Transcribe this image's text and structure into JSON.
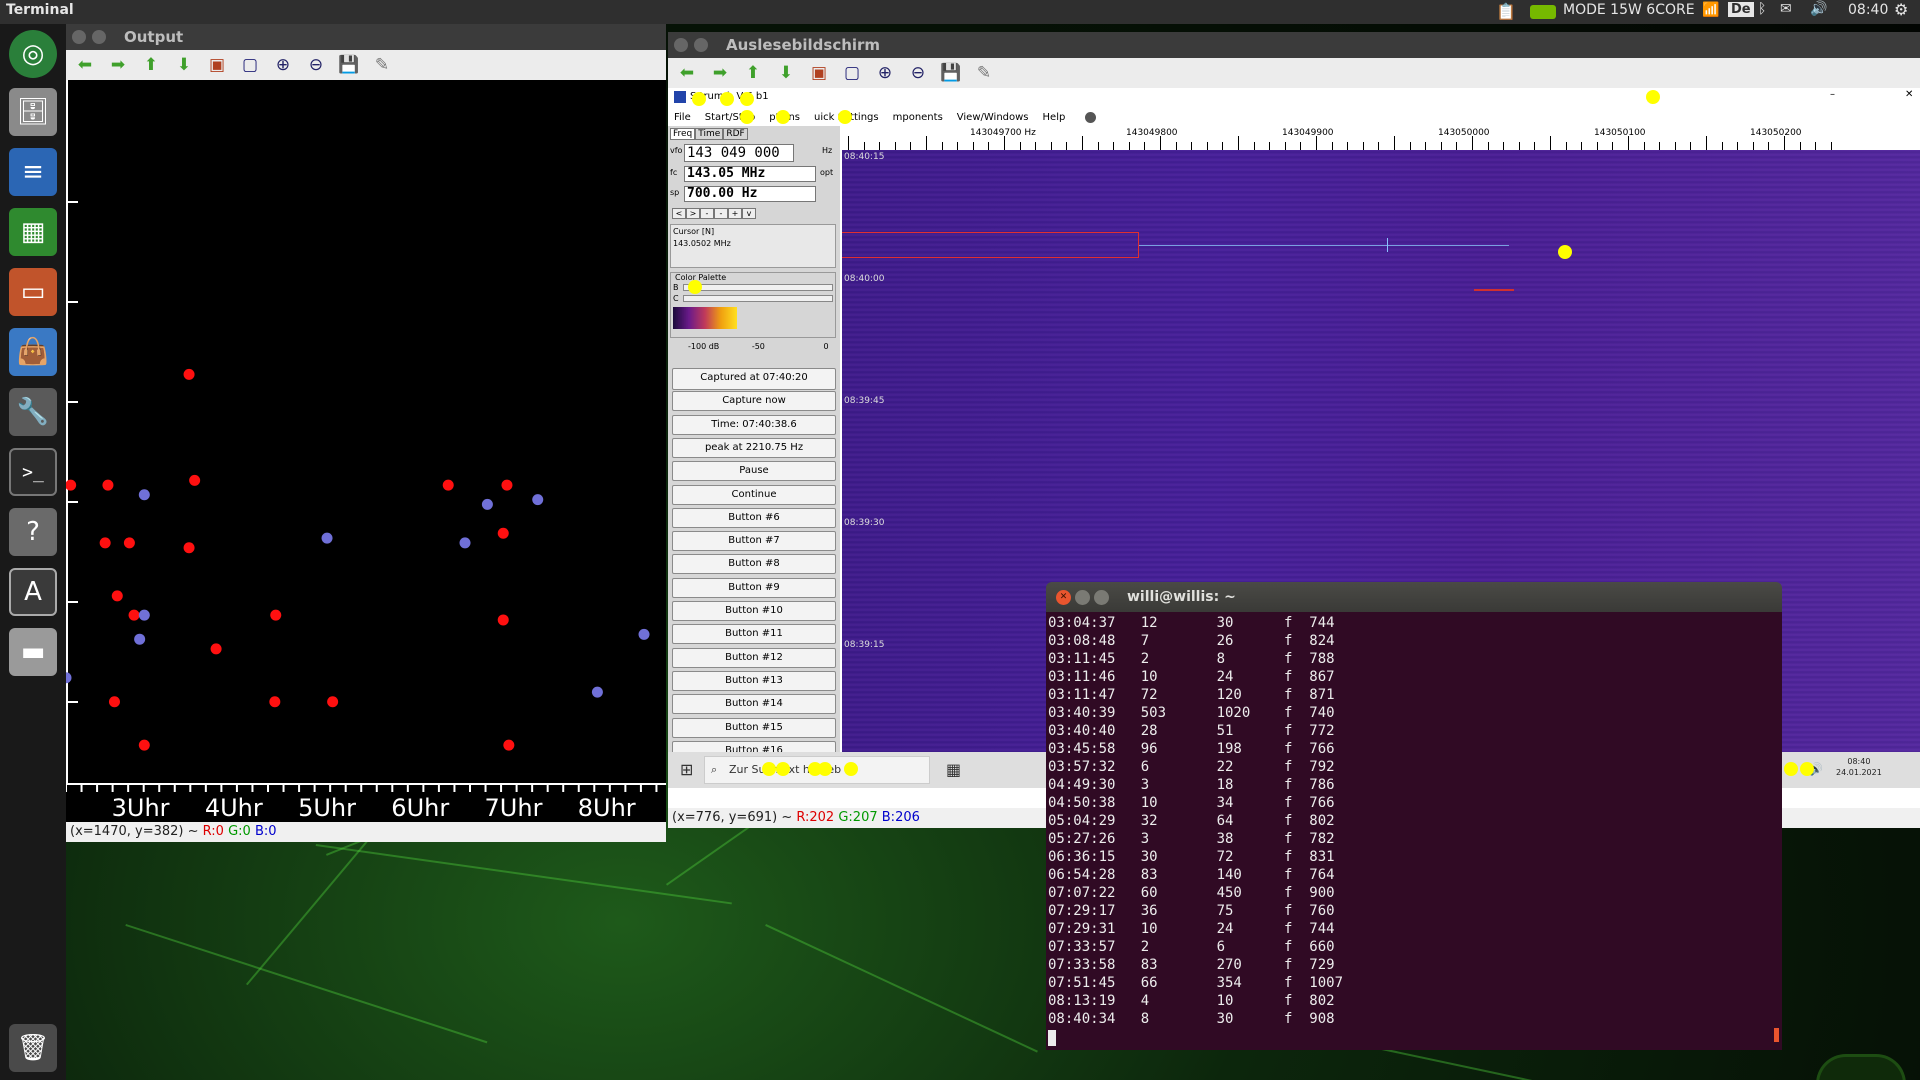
{
  "topbar": {
    "app": "Terminal",
    "gpu": "MODE 15W 6CORE",
    "keyboard": "De",
    "time": "08:40"
  },
  "output": {
    "title": "Output",
    "xticks": [
      "3Uhr",
      "4Uhr",
      "5Uhr",
      "6Uhr",
      "7Uhr",
      "8Uhr"
    ],
    "status_prefix": "(x=1470, y=382) ~ ",
    "status_r": "R:0",
    "status_g": "G:0",
    "status_b": "B:0"
  },
  "ausl": {
    "title": "Auslesebildschirm",
    "status_prefix": "(x=776, y=691) ~ ",
    "status_r": "R:202",
    "status_g": "G:207",
    "status_b": "B:206"
  },
  "sl": {
    "title": "S   trum    b V   6 b1",
    "menu": [
      "File",
      "Start/Stop",
      "  ptions",
      "   uick Settings",
      "   mponents",
      "View/Windows",
      "Help"
    ],
    "tabs": [
      "Freq",
      "Time",
      "RDF"
    ],
    "vfo_label": "vfo",
    "vfo": "143 049 000",
    "vfo_unit": "Hz",
    "fc_label": "fc",
    "fc": "143.05  MHz",
    "fc_opt": "opt",
    "sp_label": "sp",
    "sp": "700.00  Hz",
    "arrow_buttons": [
      "<",
      ">",
      "-",
      "-",
      "+",
      "v"
    ],
    "cursor_title": "Cursor [N]",
    "cursor_value": "143.0502 MHz",
    "palette_title": "Color Palette",
    "palette_b": "B",
    "palette_c": "C",
    "scale": [
      "-100 dB",
      "-50",
      "0"
    ],
    "buttons": [
      "Captured at 07:40:20",
      "Capture now",
      "Time:  07:40:38.6",
      "peak at 2210.75 Hz",
      "Pause",
      "Continue",
      "Button #6",
      "Button #7",
      "Button #8",
      "Button #9",
      "Button #10",
      "Button #11",
      "Button #12",
      "Button #13",
      "Button #14",
      "Button #15",
      "Button #16"
    ],
    "freq_labels": [
      "143049700 Hz",
      "143049800",
      "143049900",
      "143050000",
      "143050100",
      "143050200"
    ],
    "time_labels": [
      "08:40:15",
      "08:40:00",
      "08:39:45",
      "08:39:30",
      "08:39:15"
    ]
  },
  "winbar": {
    "search": "Zur Such   ext h    ngeb  ",
    "time": "08:40",
    "date": "24.01.2021"
  },
  "term": {
    "title": "willi@willis: ~",
    "rows": [
      [
        "03:04:37",
        "12",
        "30",
        "f",
        "744"
      ],
      [
        "03:08:48",
        "7",
        "26",
        "f",
        "824"
      ],
      [
        "03:11:45",
        "2",
        "8",
        "f",
        "788"
      ],
      [
        "03:11:46",
        "10",
        "24",
        "f",
        "867"
      ],
      [
        "03:11:47",
        "72",
        "120",
        "f",
        "871"
      ],
      [
        "03:40:39",
        "503",
        "1020",
        "f",
        "740"
      ],
      [
        "03:40:40",
        "28",
        "51",
        "f",
        "772"
      ],
      [
        "03:45:58",
        "96",
        "198",
        "f",
        "766"
      ],
      [
        "03:57:32",
        "6",
        "22",
        "f",
        "792"
      ],
      [
        "04:49:30",
        "3",
        "18",
        "f",
        "786"
      ],
      [
        "04:50:38",
        "10",
        "34",
        "f",
        "766"
      ],
      [
        "05:04:29",
        "32",
        "64",
        "f",
        "802"
      ],
      [
        "05:27:26",
        "3",
        "38",
        "f",
        "782"
      ],
      [
        "06:36:15",
        "30",
        "72",
        "f",
        "831"
      ],
      [
        "06:54:28",
        "83",
        "140",
        "f",
        "764"
      ],
      [
        "07:07:22",
        "60",
        "450",
        "f",
        "900"
      ],
      [
        "07:29:17",
        "36",
        "75",
        "f",
        "760"
      ],
      [
        "07:29:31",
        "10",
        "24",
        "f",
        "744"
      ],
      [
        "07:33:57",
        "2",
        "6",
        "f",
        "660"
      ],
      [
        "07:33:58",
        "83",
        "270",
        "f",
        "729"
      ],
      [
        "07:51:45",
        "66",
        "354",
        "f",
        "1007"
      ],
      [
        "08:13:19",
        "4",
        "10",
        "f",
        "802"
      ],
      [
        "08:40:34",
        "8",
        "30",
        "f",
        "908"
      ]
    ]
  },
  "chart_data": {
    "type": "scatter",
    "title": "",
    "xlabel": "",
    "ylabel": "",
    "x_ticks": [
      "3Uhr",
      "4Uhr",
      "5Uhr",
      "6Uhr",
      "7Uhr",
      "8Uhr"
    ],
    "x_unit": "hour",
    "xlim": [
      2.2,
      8.55
    ],
    "ylim": [
      0,
      7
    ],
    "series": [
      {
        "color": "#ff1010",
        "points": [
          [
            2.25,
            3.0
          ],
          [
            2.65,
            3.0
          ],
          [
            2.62,
            2.4
          ],
          [
            2.88,
            2.4
          ],
          [
            2.75,
            1.85
          ],
          [
            2.93,
            1.65
          ],
          [
            3.04,
            0.3
          ],
          [
            2.72,
            0.75
          ],
          [
            3.52,
            4.15
          ],
          [
            3.58,
            3.05
          ],
          [
            3.52,
            2.35
          ],
          [
            3.81,
            1.3
          ],
          [
            4.45,
            1.65
          ],
          [
            4.44,
            0.75
          ],
          [
            5.06,
            0.75
          ],
          [
            6.3,
            3.0
          ],
          [
            6.93,
            3.0
          ],
          [
            6.89,
            2.5
          ],
          [
            6.89,
            1.6
          ],
          [
            6.95,
            0.3
          ]
        ]
      },
      {
        "color": "#7070d8",
        "points": [
          [
            3.04,
            2.9
          ],
          [
            3.04,
            1.65
          ],
          [
            2.99,
            1.4
          ],
          [
            5.0,
            2.45
          ],
          [
            6.48,
            2.4
          ],
          [
            6.72,
            2.8
          ],
          [
            7.26,
            2.85
          ],
          [
            7.9,
            0.85
          ],
          [
            8.4,
            1.45
          ],
          [
            2.2,
            1.0
          ]
        ]
      }
    ]
  }
}
